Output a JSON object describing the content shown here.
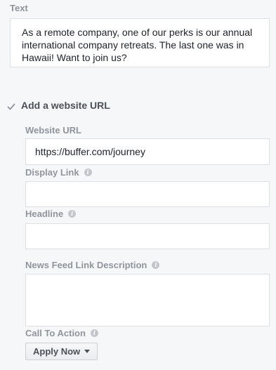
{
  "text_section": {
    "label": "Text",
    "value": "As a remote company, one of our perks is our annual\ninternational company retreats. The last one was in\nHawaii! Want to join us?"
  },
  "website_toggle": {
    "label": "Add a website URL",
    "checked": true
  },
  "website_url": {
    "label": "Website URL",
    "value": "https://buffer.com/journey"
  },
  "display_link": {
    "label": "Display Link",
    "value": ""
  },
  "headline": {
    "label": "Headline",
    "value": ""
  },
  "news_feed_description": {
    "label": "News Feed Link Description",
    "value": ""
  },
  "call_to_action": {
    "label": "Call To Action",
    "selected": "Apply Now"
  },
  "colors": {
    "background": "#f6f7f9",
    "label_gray": "#90949c",
    "border": "#dddfe2",
    "text": "#1d2129"
  }
}
